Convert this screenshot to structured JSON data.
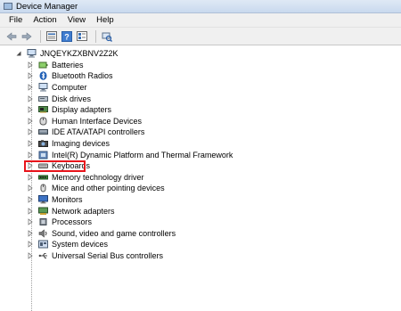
{
  "window": {
    "title": "Device Manager"
  },
  "menu": [
    "File",
    "Action",
    "View",
    "Help"
  ],
  "toolbar": {
    "buttons": [
      "back-arrow-icon",
      "forward-arrow-icon",
      "properties-icon",
      "help-icon",
      "device-list-icon",
      "scan-hardware-icon"
    ]
  },
  "tree": {
    "root": "JNQEYKZXBNV2Z2K",
    "items": [
      {
        "label": "Batteries",
        "icon": "battery-icon"
      },
      {
        "label": "Bluetooth Radios",
        "icon": "bluetooth-icon"
      },
      {
        "label": "Computer",
        "icon": "computer-icon"
      },
      {
        "label": "Disk drives",
        "icon": "disk-drive-icon"
      },
      {
        "label": "Display adapters",
        "icon": "display-adapter-icon"
      },
      {
        "label": "Human Interface Devices",
        "icon": "hid-icon"
      },
      {
        "label": "IDE ATA/ATAPI controllers",
        "icon": "ide-controller-icon"
      },
      {
        "label": "Imaging devices",
        "icon": "camera-icon"
      },
      {
        "label": "Intel(R) Dynamic Platform and Thermal Framework",
        "icon": "thermal-icon"
      },
      {
        "label": "Keyboards",
        "icon": "keyboard-icon",
        "highlighted": true
      },
      {
        "label": "Memory technology driver",
        "icon": "memory-icon"
      },
      {
        "label": "Mice and other pointing devices",
        "icon": "mouse-icon"
      },
      {
        "label": "Monitors",
        "icon": "monitor-icon"
      },
      {
        "label": "Network adapters",
        "icon": "network-adapter-icon"
      },
      {
        "label": "Processors",
        "icon": "processor-icon"
      },
      {
        "label": "Sound, video and game controllers",
        "icon": "sound-icon"
      },
      {
        "label": "System devices",
        "icon": "system-devices-icon"
      },
      {
        "label": "Universal Serial Bus controllers",
        "icon": "usb-icon"
      }
    ]
  },
  "colors": {
    "highlight": "#e8141b",
    "selection_box": "#e8141b"
  }
}
